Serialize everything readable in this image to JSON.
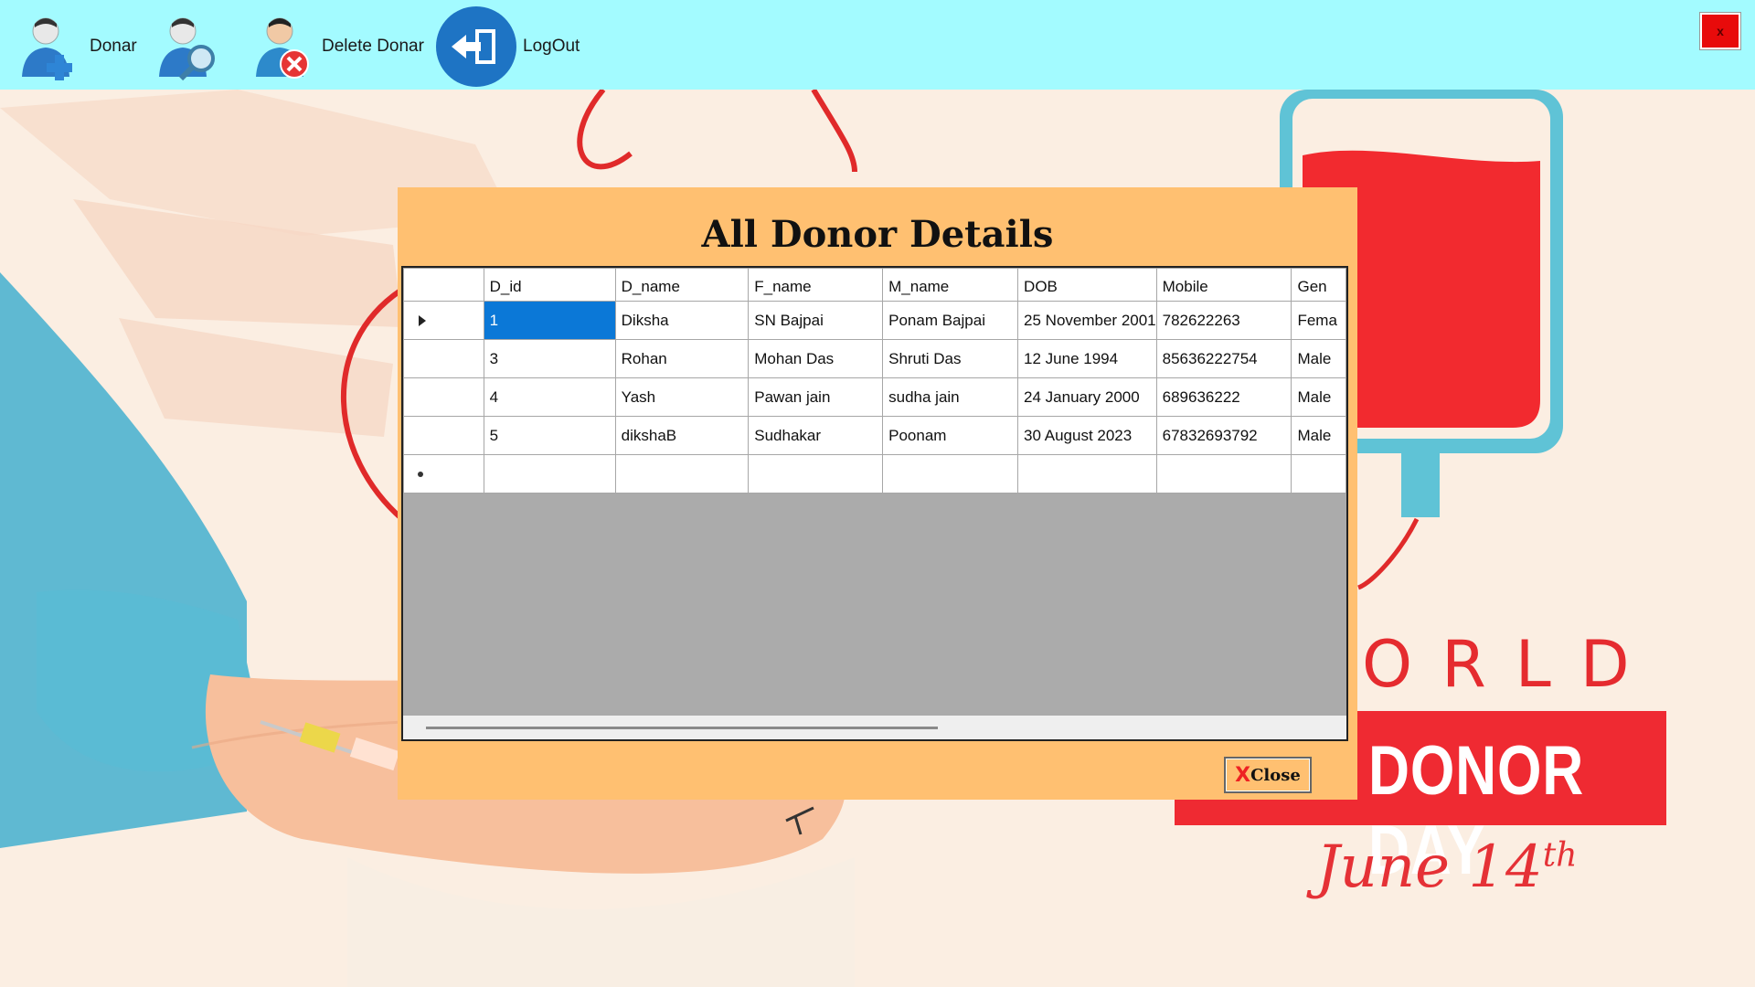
{
  "toolbar": {
    "donar_label": "Donar",
    "search_label": "",
    "delete_label": "Delete Donar",
    "logout_label": "LogOut",
    "close_label": "x"
  },
  "poster": {
    "world": "ORLD",
    "donor_day": "DONOR DAY",
    "date_main": "June 14",
    "date_suffix": "th"
  },
  "dialog": {
    "title": "All Donor Details",
    "close_label": "Close",
    "close_icon": "X"
  },
  "table": {
    "columns": [
      "D_id",
      "D_name",
      "F_name",
      "M_name",
      "DOB",
      "Mobile",
      "Gen"
    ],
    "rows": [
      [
        "1",
        "Diksha",
        "SN Bajpai",
        "Ponam Bajpai",
        "25 November 2001",
        "782622263",
        "Fema"
      ],
      [
        "3",
        "Rohan",
        "Mohan Das",
        "Shruti Das",
        "12 June 1994",
        "85636222754",
        "Male"
      ],
      [
        "4",
        "Yash",
        "Pawan jain",
        "sudha jain",
        "24 January 2000",
        "689636222",
        "Male"
      ],
      [
        "5",
        "dikshaB",
        "Sudhakar",
        "Poonam",
        "30 August 2023",
        "67832693792",
        "Male"
      ]
    ],
    "selected_row": 0,
    "selected_col": 0
  },
  "colors": {
    "toolbar_bg": "#a3fbff",
    "dialog_bg": "#ffc071",
    "selection": "#0b78d7",
    "accent_red": "#ef2a32"
  }
}
